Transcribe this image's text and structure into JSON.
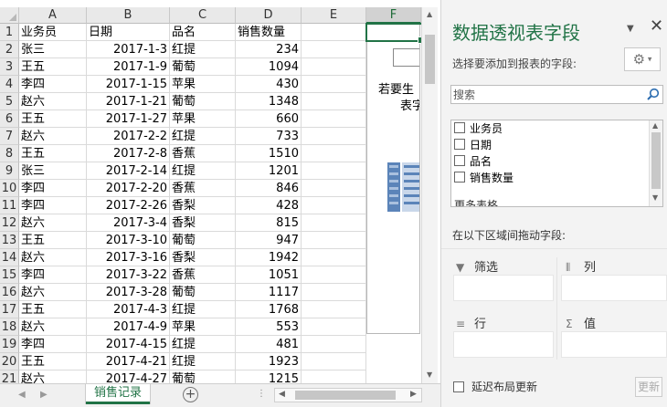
{
  "sheet": {
    "columns": [
      "A",
      "B",
      "C",
      "D",
      "E",
      "F"
    ],
    "headers": [
      "业务员",
      "日期",
      "品名",
      "销售数量"
    ],
    "rows": [
      [
        "张三",
        "2017-1-3",
        "红提",
        "234"
      ],
      [
        "王五",
        "2017-1-9",
        "葡萄",
        "1094"
      ],
      [
        "李四",
        "2017-1-15",
        "苹果",
        "430"
      ],
      [
        "赵六",
        "2017-1-21",
        "葡萄",
        "1348"
      ],
      [
        "王五",
        "2017-1-27",
        "苹果",
        "660"
      ],
      [
        "赵六",
        "2017-2-2",
        "红提",
        "733"
      ],
      [
        "王五",
        "2017-2-8",
        "香蕉",
        "1510"
      ],
      [
        "张三",
        "2017-2-14",
        "红提",
        "1201"
      ],
      [
        "李四",
        "2017-2-20",
        "香蕉",
        "846"
      ],
      [
        "李四",
        "2017-2-26",
        "香梨",
        "428"
      ],
      [
        "赵六",
        "2017-3-4",
        "香梨",
        "815"
      ],
      [
        "王五",
        "2017-3-10",
        "葡萄",
        "947"
      ],
      [
        "赵六",
        "2017-3-16",
        "香梨",
        "1942"
      ],
      [
        "李四",
        "2017-3-22",
        "香蕉",
        "1051"
      ],
      [
        "赵六",
        "2017-3-28",
        "葡萄",
        "1117"
      ],
      [
        "王五",
        "2017-4-3",
        "红提",
        "1768"
      ],
      [
        "赵六",
        "2017-4-9",
        "苹果",
        "553"
      ],
      [
        "李四",
        "2017-4-15",
        "红提",
        "481"
      ],
      [
        "王五",
        "2017-4-21",
        "红提",
        "1923"
      ],
      [
        "赵六",
        "2017-4-27",
        "葡萄",
        "1215"
      ]
    ],
    "row_numbers": [
      "1",
      "2",
      "3",
      "4",
      "5",
      "6",
      "7",
      "8",
      "9",
      "10",
      "11",
      "12",
      "13",
      "14",
      "15",
      "16",
      "17",
      "18",
      "19",
      "20",
      "21"
    ],
    "pivot_placeholder_text": [
      "若要生",
      "表字"
    ],
    "tab_label": "销售记录",
    "add_sheet": "⊕"
  },
  "pane": {
    "title": "数据透视表字段",
    "subtitle": "选择要添加到报表的字段:",
    "search_placeholder": "搜索",
    "fields": [
      "业务员",
      "日期",
      "品名",
      "销售数量"
    ],
    "more_tables": "更多表格...",
    "drag_hint": "在以下区域间拖动字段:",
    "areas": {
      "filter": "筛选",
      "columns": "列",
      "rows": "行",
      "values": "值"
    },
    "defer_label": "延迟布局更新",
    "update_label": "更新"
  },
  "colors": {
    "accent": "#217346"
  }
}
